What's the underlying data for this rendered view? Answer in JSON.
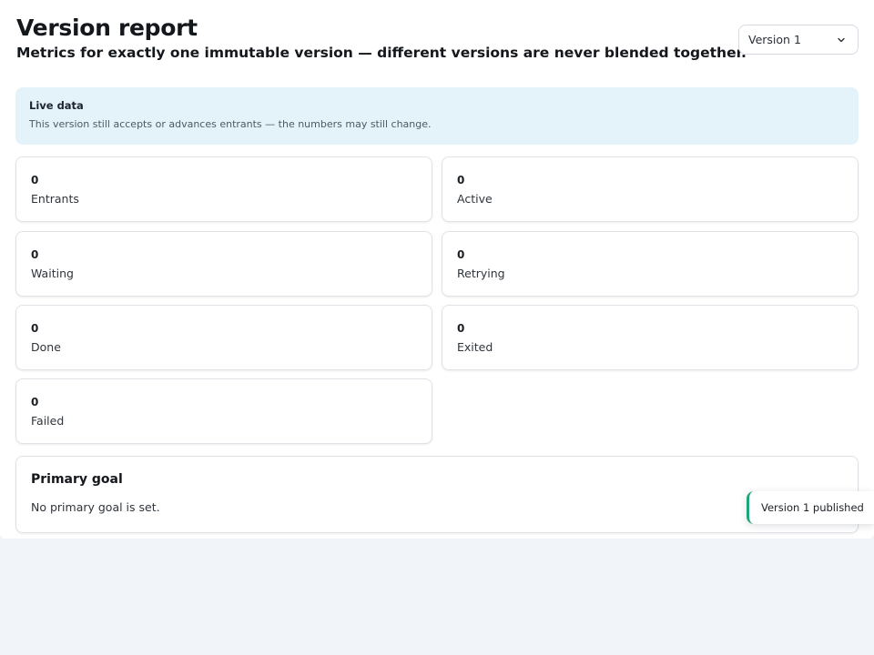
{
  "header": {
    "title": "Version report",
    "subtitle": "Metrics for exactly one immutable version — different versions are never blended together."
  },
  "version_select": {
    "selected": "Version 1"
  },
  "live_banner": {
    "title": "Live data",
    "text": "This version still accepts or advances entrants — the numbers may still change."
  },
  "metrics": [
    {
      "value": "0",
      "label": "Entrants"
    },
    {
      "value": "0",
      "label": "Active"
    },
    {
      "value": "0",
      "label": "Waiting"
    },
    {
      "value": "0",
      "label": "Retrying"
    },
    {
      "value": "0",
      "label": "Done"
    },
    {
      "value": "0",
      "label": "Exited"
    },
    {
      "value": "0",
      "label": "Failed"
    }
  ],
  "goal": {
    "title": "Primary goal",
    "text": "No primary goal is set."
  },
  "toast": {
    "text": "Version 1 published"
  },
  "colors": {
    "banner_bg": "#e4f2fa",
    "toast_accent": "#1fa57a",
    "page_bg": "#f1f4f8"
  }
}
